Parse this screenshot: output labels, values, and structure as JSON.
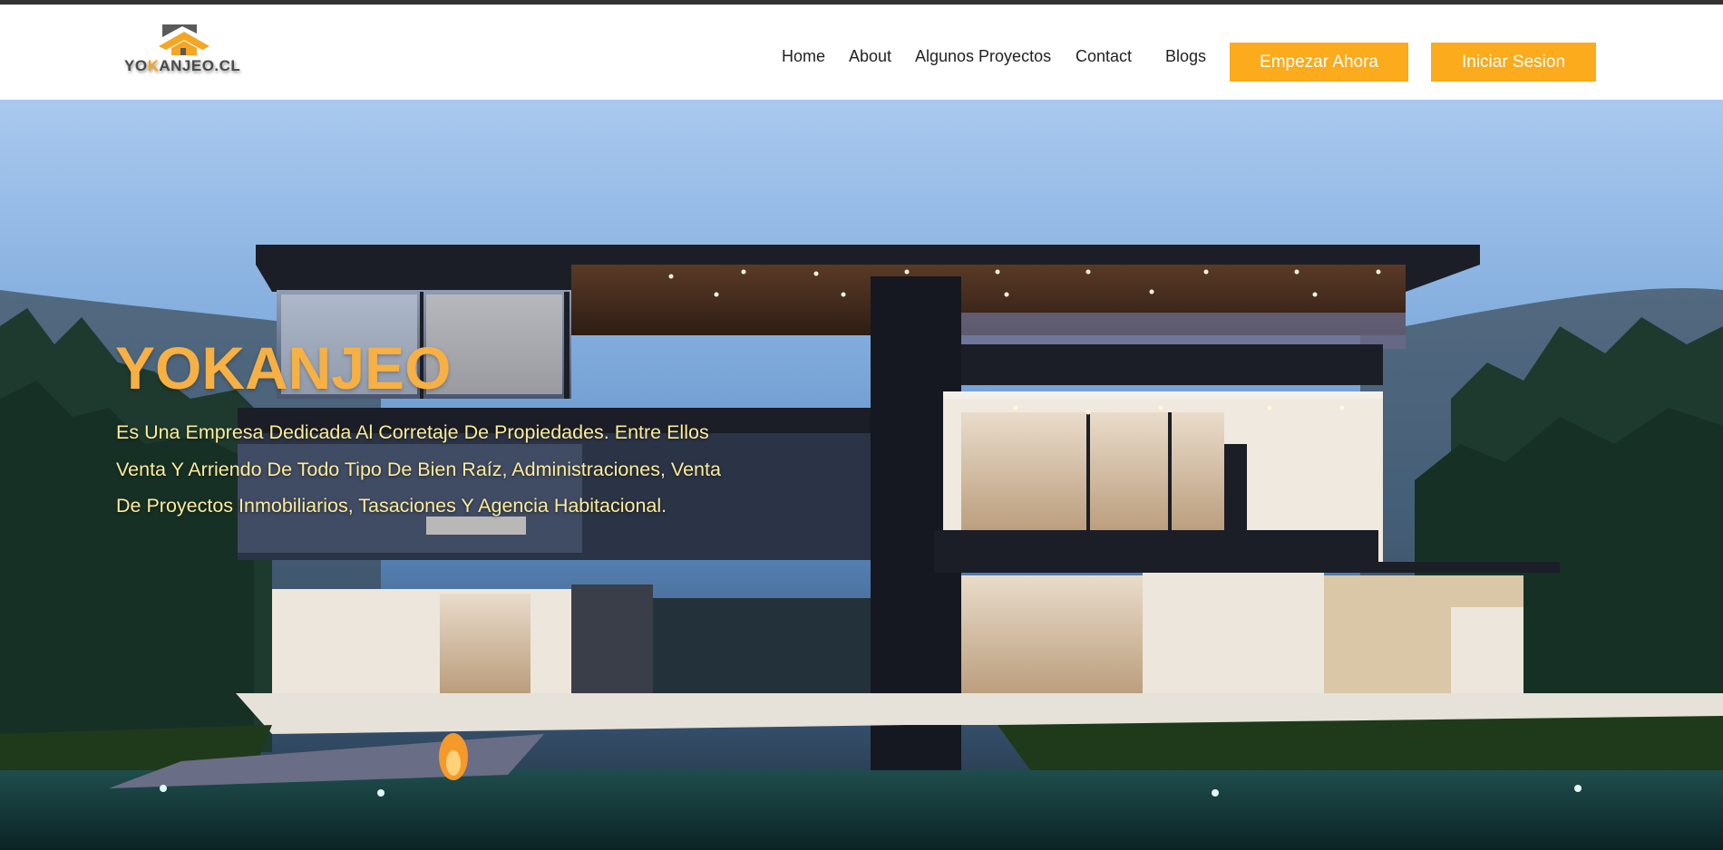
{
  "logo": {
    "text_a": "YO",
    "text_b": "K",
    "text_c": "ANJEO.CL",
    "icon": "house-roof-logo-icon",
    "accent_color": "#f5a623"
  },
  "nav": {
    "items": [
      {
        "label": "Home"
      },
      {
        "label": "About"
      },
      {
        "label": "Algunos Proyectos"
      },
      {
        "label": "Contact"
      },
      {
        "label": "Blogs"
      }
    ],
    "cta_primary": "Empezar Ahora",
    "cta_secondary": "Iniciar Sesion",
    "button_color": "#fbab1b"
  },
  "hero": {
    "title": "YOKANJEO",
    "lines": [
      "Es Una Empresa Dedicada Al Corretaje De Propiedades. Entre Ellos",
      "Venta Y Arriendo De Todo Tipo De Bien Raíz, Administraciones, Venta",
      "De Proyectos Inmobiliarios, Tasaciones Y Agencia Habitacional."
    ],
    "title_color": "#f6b043",
    "text_color": "#fbec9a",
    "background": "modern-house-at-dusk-photo"
  }
}
